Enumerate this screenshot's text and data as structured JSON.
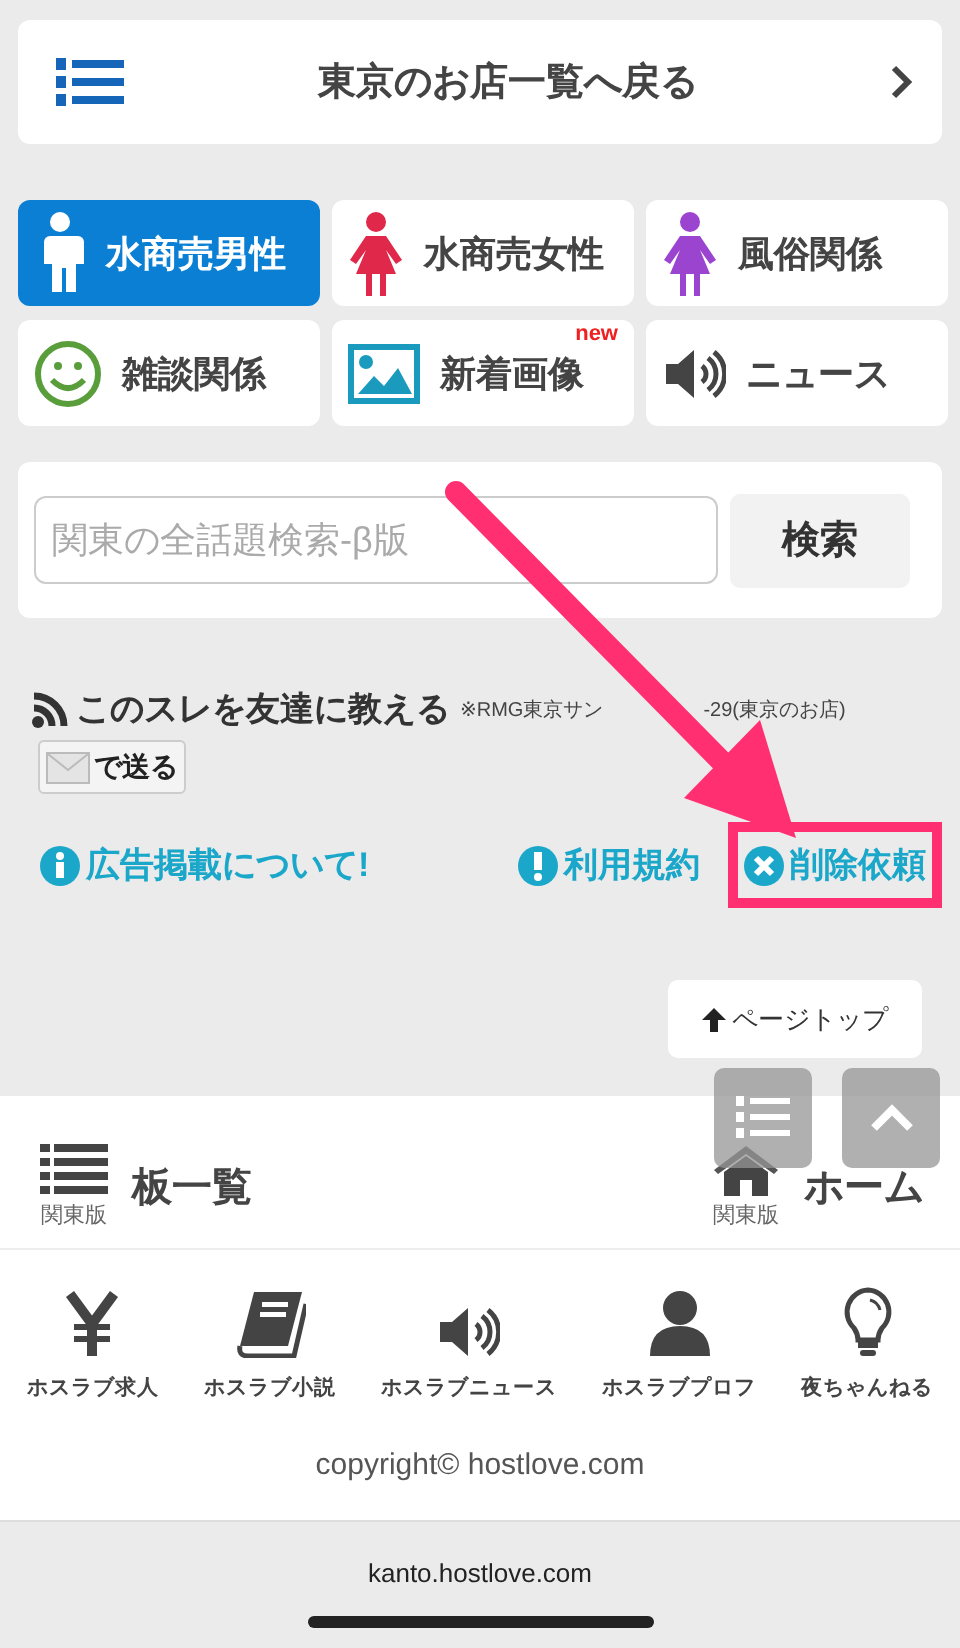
{
  "back_link": {
    "label": "東京のお店一覧へ戻る"
  },
  "categories": [
    {
      "label": "水商売男性",
      "kind": "man",
      "selected": true
    },
    {
      "label": "水商売女性",
      "kind": "woman",
      "color": "#e0284a",
      "selected": false
    },
    {
      "label": "風俗関係",
      "kind": "woman",
      "color": "#9b44d0",
      "selected": false
    },
    {
      "label": "雑談関係",
      "kind": "smile",
      "selected": false
    },
    {
      "label": "新着画像",
      "kind": "image",
      "selected": false,
      "badge": "new"
    },
    {
      "label": "ニュース",
      "kind": "speaker",
      "selected": false
    }
  ],
  "search": {
    "placeholder": "関東の全話題検索-β版",
    "button": "検索"
  },
  "share": {
    "title": "このスレを友達に教える",
    "note_parts": [
      "※RMG東京サン",
      "-29(東京のお店)"
    ],
    "mail_button": "で送る"
  },
  "links": [
    {
      "label": "広告掲載について!",
      "kind": "info",
      "highlighted": false
    },
    {
      "label": "利用規約",
      "kind": "alert",
      "highlighted": false
    },
    {
      "label": "削除依頼",
      "kind": "delete",
      "highlighted": true
    }
  ],
  "page_top": "ページトップ",
  "footer": {
    "nav": [
      {
        "label": "板一覧",
        "sub": "関東版",
        "kind": "list"
      },
      {
        "label": "ホーム",
        "sub": "関東版",
        "kind": "home"
      }
    ],
    "services": [
      {
        "label": "ホスラブ求人",
        "kind": "yen"
      },
      {
        "label": "ホスラブ小説",
        "kind": "book"
      },
      {
        "label": "ホスラブニュース",
        "kind": "speaker"
      },
      {
        "label": "ホスラブプロフ",
        "kind": "person"
      },
      {
        "label": "夜ちゃんねる",
        "kind": "bulb"
      }
    ],
    "copyright": "copyright© hostlove.com"
  },
  "browser": {
    "url": "kanto.hostlove.com"
  }
}
